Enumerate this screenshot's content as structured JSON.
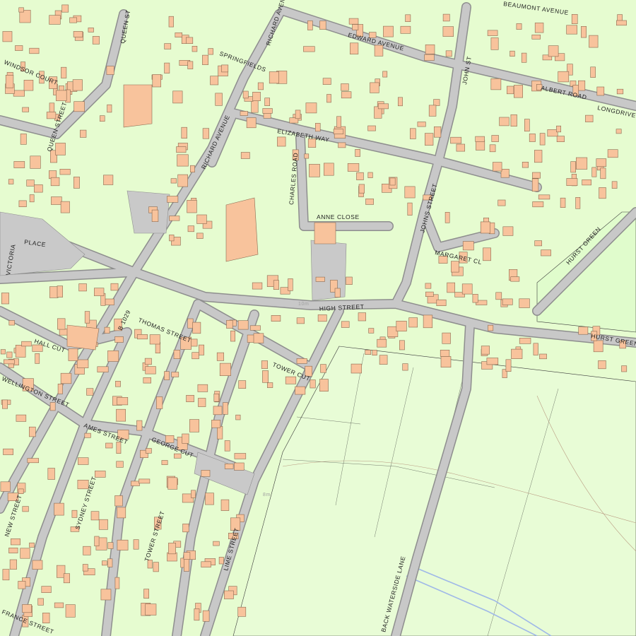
{
  "map": {
    "background_color": "#e6fcd0",
    "road_color": "#c8c8c8",
    "building_color": "#f8c39c",
    "open_space_color": "#e8fcd6",
    "street_labels": {
      "queen_st": "QUEEN ST",
      "springfields": "SPRINGFIELDS",
      "richard_avenue_north": "RICHARD AVENUE",
      "richard_avenue_south": "RICHARD AVENUE",
      "edward_avenue": "EDWARD AVENUE",
      "beaumont_avenue": "BEAUMONT AVENUE",
      "john_st": "JOHN ST",
      "albert_road": "ALBERT ROAD",
      "longdrive": "LONGDRIVE",
      "windsor_court": "WINDSOR COURT",
      "queen_street": "QUEEN STREET",
      "elizabeth_way": "ELIZABETH WAY",
      "charles_road": "CHARLES ROAD",
      "anne_close": "ANNE CLOSE",
      "johns_street": "JOHNS STREET",
      "margaret_cl": "MARGARET CL",
      "hurst_green_road": "HURST GREEN",
      "place": "PLACE",
      "victoria": "VICTORIA",
      "high_street": "HIGH STREET",
      "b1029": "B 1029",
      "thomas_street": "THOMAS STREET",
      "hall_cut": "HALL CUT",
      "tower_cut": "TOWER CUT",
      "hurst_green_east": "HURST GREEN",
      "wellington_street": "WELLINGTON STREET",
      "ames_street": "AMES STREET",
      "george_cut": "GEORGE CUT",
      "new_street": "NEW STREET",
      "sydney_street": "SYDNEY STREET",
      "tower_street": "TOWER STREET",
      "lime_street": "LIME STREET",
      "back_waterside_lane": "BACK WATERSIDE LANE",
      "france_street": "FRANCE STREET"
    },
    "spot_heights": {
      "high_street_height": "10m",
      "lime_street_height": "8m"
    }
  }
}
